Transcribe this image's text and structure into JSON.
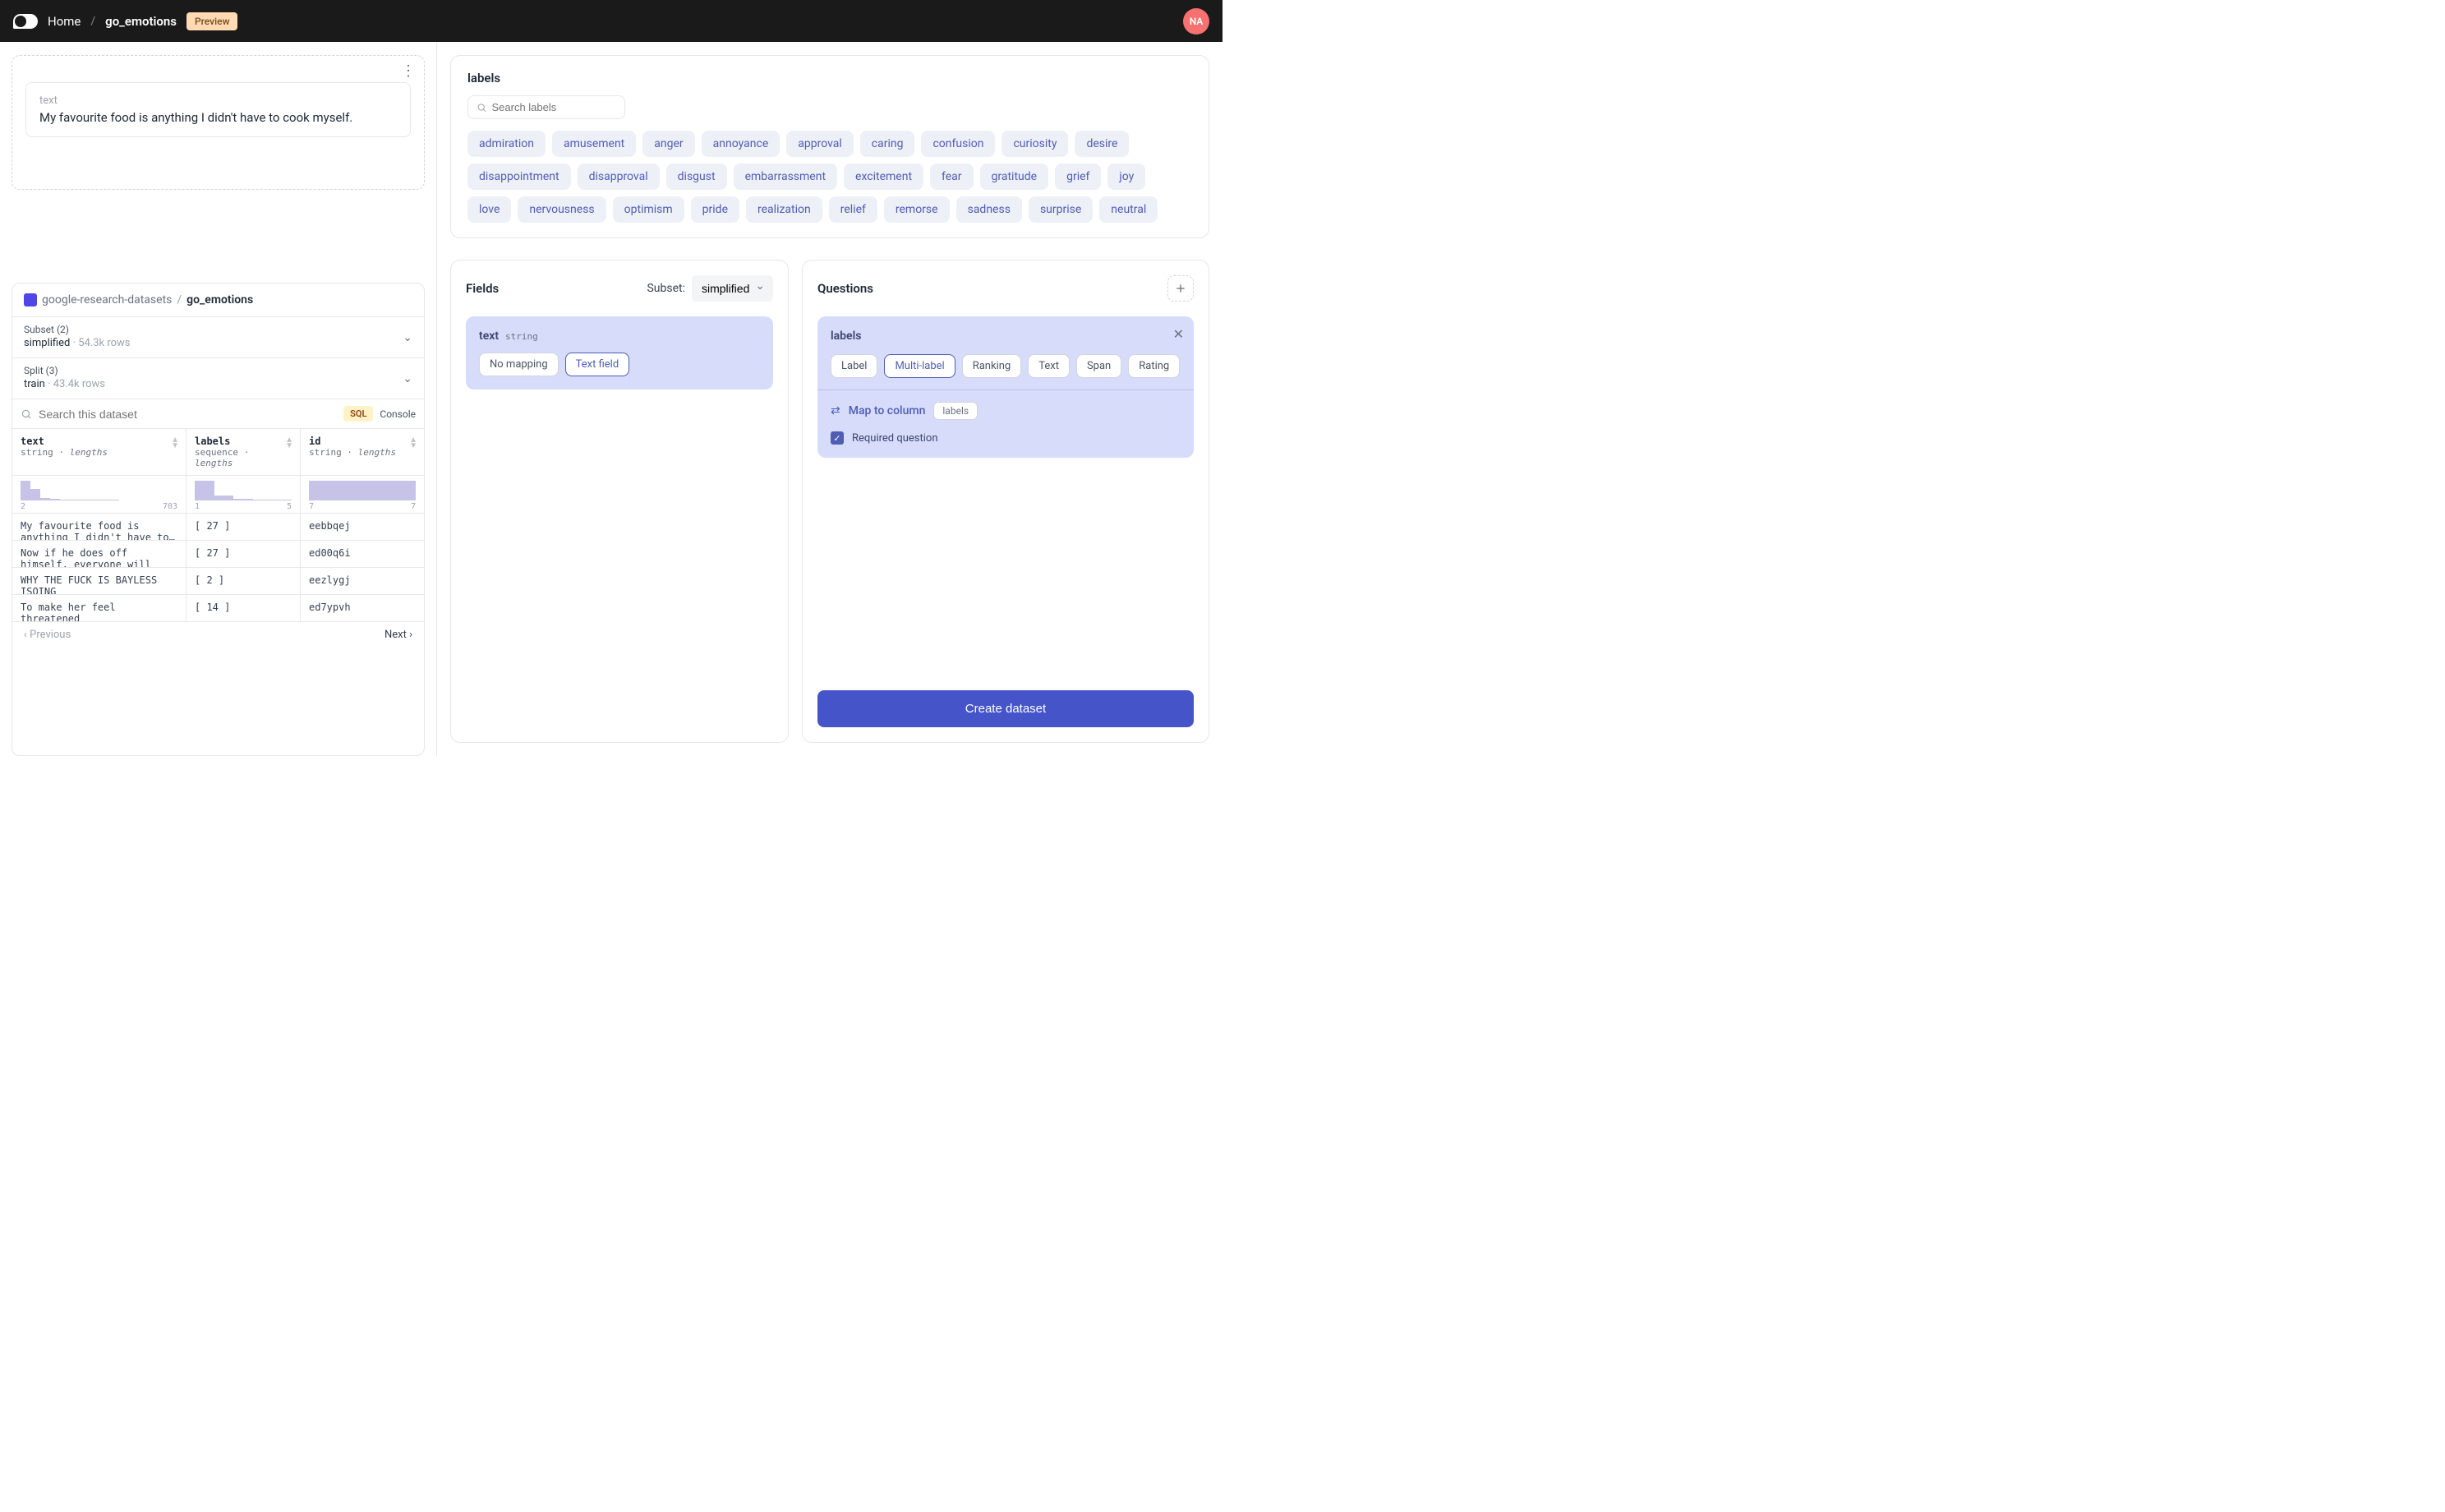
{
  "header": {
    "home": "Home",
    "slash": "/",
    "name": "go_emotions",
    "preview": "Preview",
    "avatar": "NA"
  },
  "preview": {
    "text_label": "text",
    "text_content": "My favourite food is anything I didn't have to cook myself."
  },
  "dataset": {
    "org": "google-research-datasets",
    "slash": "/",
    "name": "go_emotions",
    "subset_label": "Subset (2)",
    "subset_value": "simplified",
    "subset_rows": "54.3k rows",
    "split_label": "Split (3)",
    "split_value": "train",
    "split_rows": "43.4k rows",
    "search_placeholder": "Search this dataset",
    "sql_badge": "SQL",
    "console": "Console",
    "columns": [
      {
        "name": "text",
        "type": "string",
        "extra": "lengths",
        "min": "2",
        "max": "703"
      },
      {
        "name": "labels",
        "type": "sequence",
        "extra": "lengths",
        "min": "1",
        "max": "5"
      },
      {
        "name": "id",
        "type": "string",
        "extra": "lengths",
        "min": "7",
        "max": "7"
      }
    ],
    "rows": [
      {
        "text": "My favourite food is anything I didn't have to…",
        "labels": "[ 27 ]",
        "id": "eebbqej"
      },
      {
        "text": "Now if he does off himself, everyone will think hes…",
        "labels": "[ 27 ]",
        "id": "ed00q6i"
      },
      {
        "text": "WHY THE FUCK IS BAYLESS ISOING",
        "labels": "[ 2 ]",
        "id": "eezlygj"
      },
      {
        "text": "To make her feel threatened",
        "labels": "[ 14 ]",
        "id": "ed7ypvh"
      }
    ],
    "prev": "Previous",
    "next": "Next"
  },
  "labels": {
    "title": "labels",
    "search_placeholder": "Search labels",
    "items": [
      "admiration",
      "amusement",
      "anger",
      "annoyance",
      "approval",
      "caring",
      "confusion",
      "curiosity",
      "desire",
      "disappointment",
      "disapproval",
      "disgust",
      "embarrassment",
      "excitement",
      "fear",
      "gratitude",
      "grief",
      "joy",
      "love",
      "nervousness",
      "optimism",
      "pride",
      "realization",
      "relief",
      "remorse",
      "sadness",
      "surprise",
      "neutral"
    ]
  },
  "fields": {
    "title": "Fields",
    "subset_label": "Subset:",
    "subset_value": "simplified",
    "card": {
      "name": "text",
      "type": "string",
      "options": [
        "No mapping",
        "Text field"
      ],
      "active": "Text field"
    }
  },
  "questions": {
    "title": "Questions",
    "card": {
      "title": "labels",
      "options": [
        "Label",
        "Multi-label",
        "Ranking",
        "Text",
        "Span",
        "Rating"
      ],
      "active": "Multi-label",
      "map_text": "Map to column",
      "map_value": "labels",
      "required": "Required question"
    },
    "create": "Create dataset"
  }
}
